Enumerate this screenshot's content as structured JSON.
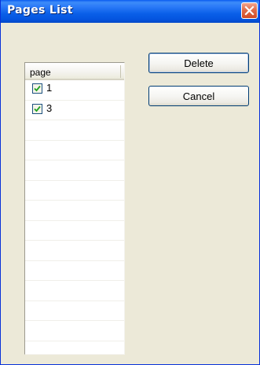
{
  "window": {
    "title": "Pages List",
    "close_icon": "close-x-icon",
    "colors": {
      "titlebar": "#0a5fe8",
      "close": "#d34b25",
      "face": "#ece9d8"
    }
  },
  "list": {
    "header": "page",
    "rows": [
      {
        "label": "1",
        "checked": true
      },
      {
        "label": "3",
        "checked": true
      }
    ],
    "empty_rows": 12
  },
  "buttons": {
    "delete_label": "Delete",
    "cancel_label": "Cancel"
  }
}
